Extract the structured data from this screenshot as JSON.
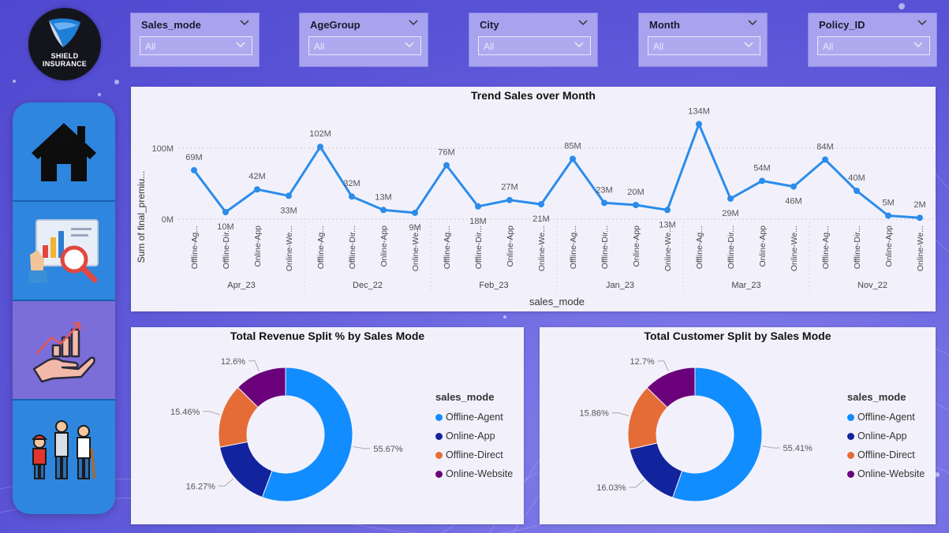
{
  "logo": {
    "line1": "SHIELD",
    "line2": "INSURANCE"
  },
  "nav": [
    {
      "id": "home",
      "icon": "home-icon"
    },
    {
      "id": "analysis",
      "icon": "report-magnifier-icon"
    },
    {
      "id": "growth",
      "icon": "hand-growth-chart-icon",
      "active": true
    },
    {
      "id": "age-groups",
      "icon": "age-group-people-icon"
    }
  ],
  "slicers": [
    {
      "title": "Sales_mode",
      "value": "All"
    },
    {
      "title": "AgeGroup",
      "value": "All"
    },
    {
      "title": "City",
      "value": "All"
    },
    {
      "title": "Month",
      "value": "All"
    },
    {
      "title": "Policy_ID",
      "value": "All"
    }
  ],
  "colors": {
    "blue": "#118dff",
    "navy": "#12239e",
    "orange": "#e66c37",
    "purple": "#6b007b",
    "line": "#2b8ceb"
  },
  "trend": {
    "title": "Trend Sales over Month",
    "chart_data": {
      "type": "line",
      "title": "Trend Sales over Month",
      "xlabel": "sales_mode",
      "ylabel": "Sum of final_premiu...",
      "y_ticks": [
        "0M",
        "100M"
      ],
      "ylim": [
        0,
        140
      ],
      "months": [
        "Apr_23",
        "Dec_22",
        "Feb_23",
        "Jan_23",
        "Mar_23",
        "Nov_22"
      ],
      "modes": [
        "Offline-Ag...",
        "Offline-Dir...",
        "Online-App",
        "Online-We..."
      ],
      "values": [
        69,
        10,
        42,
        33,
        102,
        32,
        13,
        9,
        76,
        18,
        27,
        21,
        85,
        23,
        20,
        13,
        134,
        29,
        54,
        46,
        84,
        40,
        5,
        2
      ],
      "labels": [
        "69M",
        "10M",
        "42M",
        "33M",
        "102M",
        "32M",
        "13M",
        "9M",
        "76M",
        "18M",
        "27M",
        "21M",
        "85M",
        "23M",
        "20M",
        "13M",
        "134M",
        "29M",
        "54M",
        "46M",
        "84M",
        "40M",
        "5M",
        "2M"
      ],
      "grid": true
    }
  },
  "revenue": {
    "title": "Total Revenue Split % by Sales Mode",
    "chart_data": {
      "type": "pie",
      "title": "Total Revenue Split % by Sales Mode",
      "legend_title": "sales_mode",
      "slices": [
        {
          "name": "Offline-Agent",
          "value": 55.67,
          "label": "55.67%"
        },
        {
          "name": "Online-App",
          "value": 16.27,
          "label": "16.27%"
        },
        {
          "name": "Offline-Direct",
          "value": 15.46,
          "label": "15.46%"
        },
        {
          "name": "Online-Website",
          "value": 12.6,
          "label": "12.6%"
        }
      ]
    }
  },
  "customers": {
    "title": "Total Customer Split by Sales Mode",
    "chart_data": {
      "type": "pie",
      "title": "Total Customer Split by Sales Mode",
      "legend_title": "sales_mode",
      "slices": [
        {
          "name": "Offline-Agent",
          "value": 55.41,
          "label": "55.41%"
        },
        {
          "name": "Online-App",
          "value": 16.03,
          "label": "16.03%"
        },
        {
          "name": "Offline-Direct",
          "value": 15.86,
          "label": "15.86%"
        },
        {
          "name": "Online-Website",
          "value": 12.7,
          "label": "12.7%"
        }
      ]
    }
  }
}
